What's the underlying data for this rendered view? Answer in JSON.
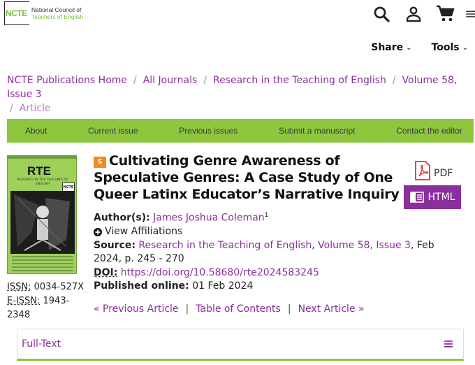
{
  "logo": {
    "mark": "NCTE",
    "line1": "National Council of",
    "line2": "Teachers of English",
    "accent": "#7ac143"
  },
  "header_icons": [
    "search-icon",
    "account-icon",
    "cart-icon",
    "hamburger-menu-icon"
  ],
  "menus": {
    "share": "Share",
    "tools": "Tools"
  },
  "breadcrumb": {
    "items": [
      "NCTE Publications Home",
      "All Journals",
      "Research in the Teaching of English",
      "Volume 58, Issue 3"
    ],
    "current": "Article",
    "separator": "/"
  },
  "nav": {
    "about": "About",
    "current_issue": "Current issue",
    "previous_issues": "Previous issues",
    "submit": "Submit a manuscript",
    "contact": "Contact the editor",
    "color": "#8ec63f"
  },
  "cover": {
    "title": "RTE",
    "subtitle": "RESEARCH IN THE TEACHING OF ENGLISH",
    "logo_mark": "NCTE"
  },
  "issn": {
    "print_label": "ISSN:",
    "print_value": "0034-527X",
    "e_label": "E-ISSN:",
    "e_value": "1943-2348"
  },
  "article": {
    "badge": "S",
    "title": "Cultivating Genre Awareness of Speculative Genres: A Case Study of One Queer Latinx Educator’s Narrative Inquiry",
    "pdf_label": "PDF",
    "html_label": "HTML",
    "authors_label": "Author(s):",
    "author": "James Joshua Coleman",
    "author_sup": "1",
    "view_affiliations": "View Affiliations",
    "source_label": "Source:",
    "source_journal": "Research in the Teaching of English",
    "source_issue": "Volume 58, Issue 3",
    "source_rest": ", Feb 2024, p. 245 - 270",
    "doi_label": "DOI:",
    "doi_value": "https://doi.org/10.58680/rte2024583245",
    "published_label": "Published online:",
    "published_value": "01 Feb 2024"
  },
  "pager": {
    "previous": "« Previous Article",
    "toc": "Table of Contents",
    "next": "Next Article »"
  },
  "fulltext": {
    "label": "Full-Text"
  },
  "colors": {
    "purple": "#8a2f9e",
    "green": "#8ec63f",
    "orange": "#f08a24"
  }
}
